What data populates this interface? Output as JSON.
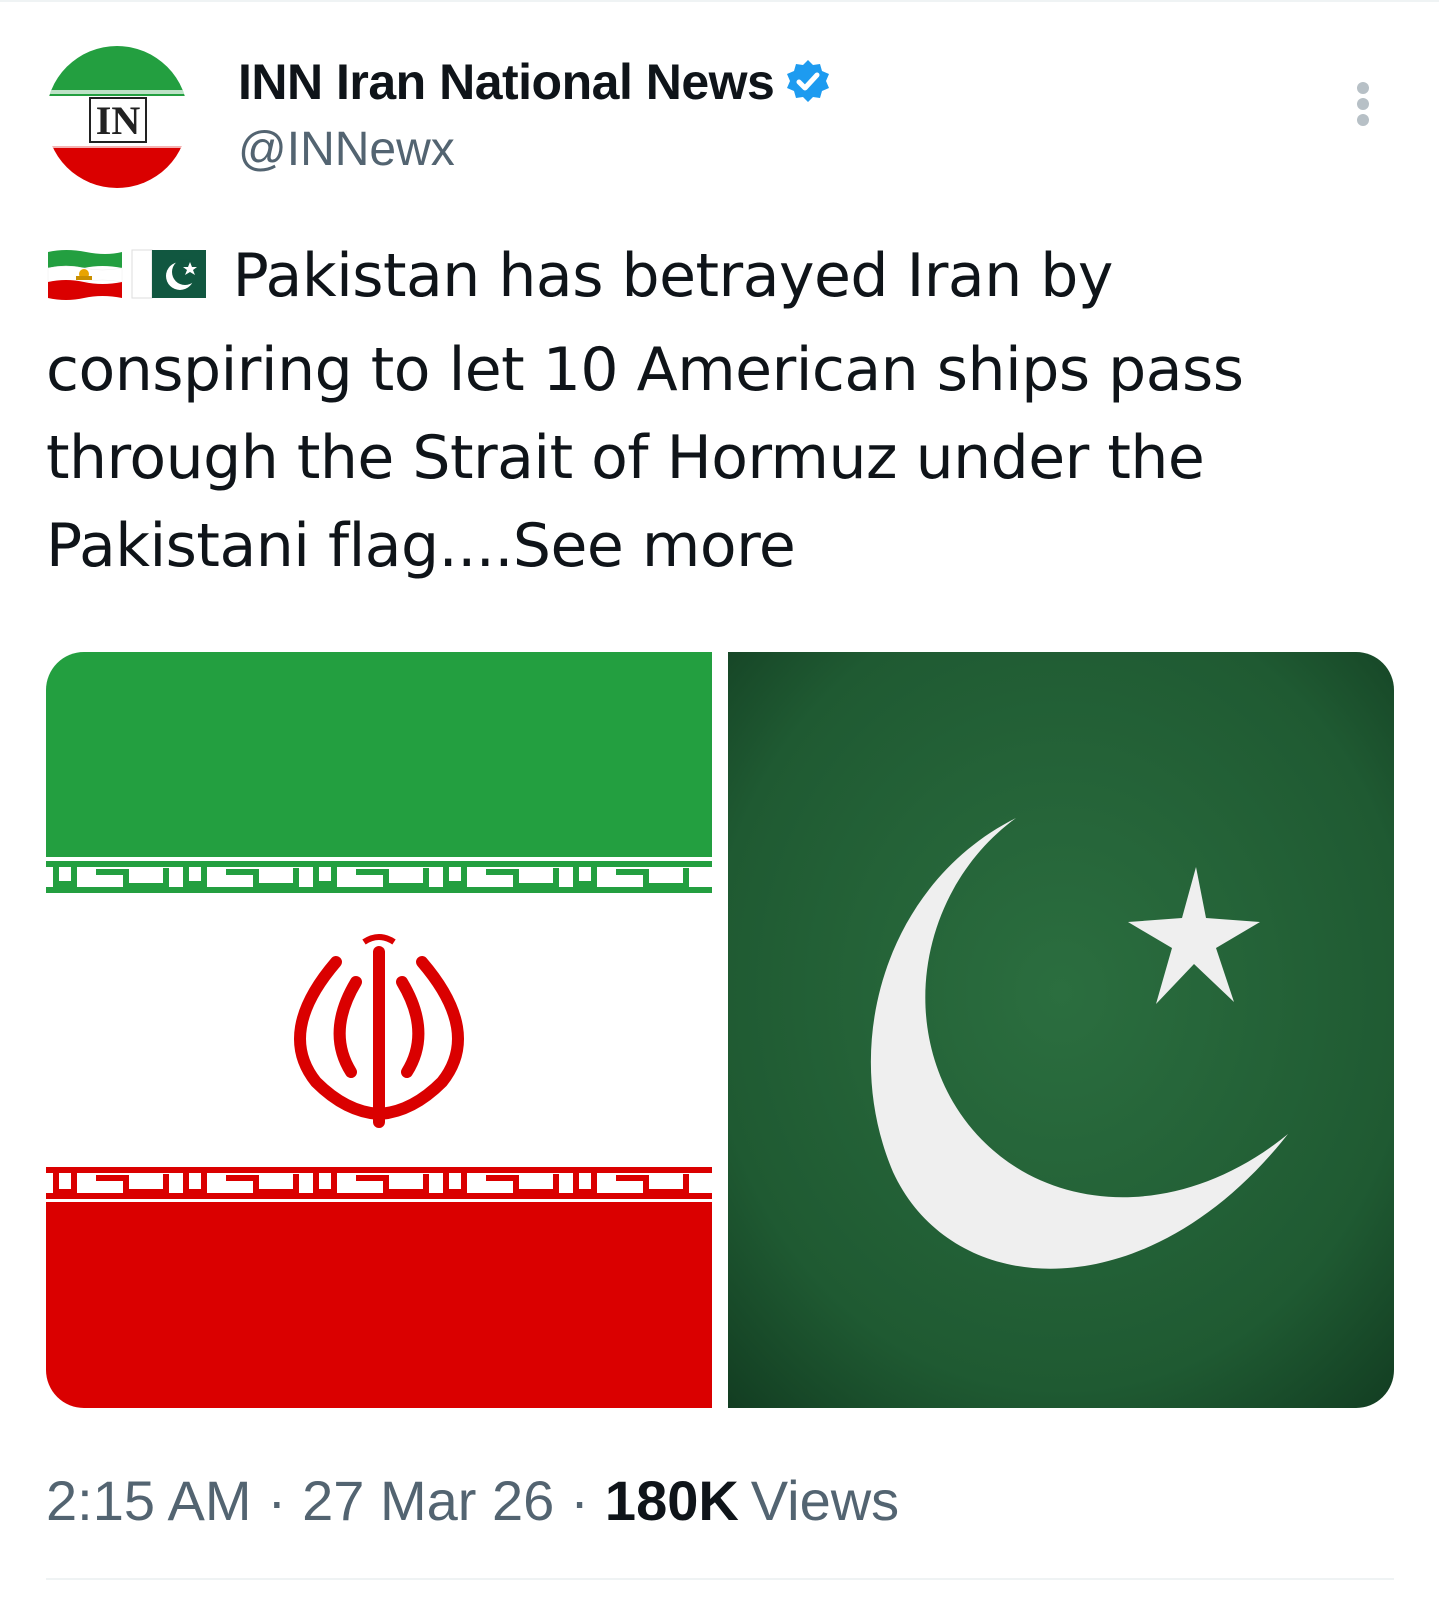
{
  "author": {
    "display_name": "INN Iran National News",
    "handle": "@INNewx",
    "verified": true,
    "avatar_text": "IN"
  },
  "tweet": {
    "text": " Pakistan has betrayed Iran by conspiring to let 10 American ships pass through the Strait of Hormuz under the Pakistani flag...",
    "see_more": ".See more",
    "flag_emojis": [
      "lion-and-sun-iran-flag-icon",
      "pakistan-flag-icon"
    ]
  },
  "media": [
    {
      "name": "iran-flag-image",
      "colors": {
        "green": "#239f40",
        "white": "#ffffff",
        "red": "#da0000"
      }
    },
    {
      "name": "pakistan-flag-image",
      "colors": {
        "green": "#1f5a32",
        "white": "#f2f2f2"
      }
    }
  ],
  "meta": {
    "time": "2:15 AM",
    "separator": "·",
    "date": "27 Mar 26",
    "views_count": "180K",
    "views_label": "Views"
  },
  "colors": {
    "text": "#0f1419",
    "secondary": "#536471",
    "verified_blue": "#1d9bf0"
  }
}
